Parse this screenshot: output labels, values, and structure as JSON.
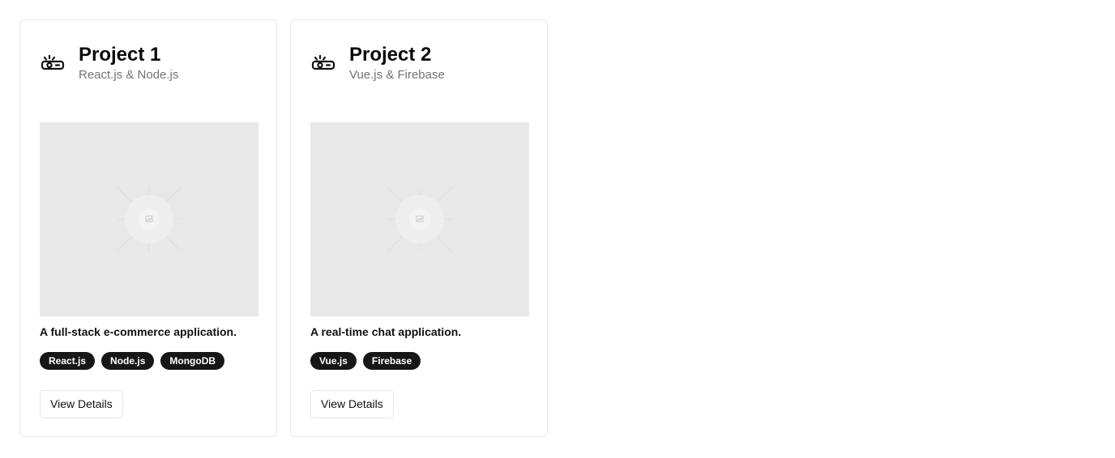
{
  "projects": [
    {
      "title": "Project 1",
      "subtitle": "React.js & Node.js",
      "icon": "projector-icon",
      "image_icon": "image-icon",
      "description": "A full-stack e-commerce application.",
      "tags": [
        "React.js",
        "Node.js",
        "MongoDB"
      ],
      "button_label": "View Details"
    },
    {
      "title": "Project 2",
      "subtitle": "Vue.js & Firebase",
      "icon": "projector-icon",
      "image_icon": "image-icon",
      "description": "A real-time chat application.",
      "tags": [
        "Vue.js",
        "Firebase"
      ],
      "button_label": "View Details"
    }
  ],
  "colors": {
    "tag_background": "#171717",
    "tag_text": "#ffffff",
    "placeholder_background": "#e8e8e8",
    "subtitle_text": "#737373",
    "card_border": "#e5e5e5"
  }
}
